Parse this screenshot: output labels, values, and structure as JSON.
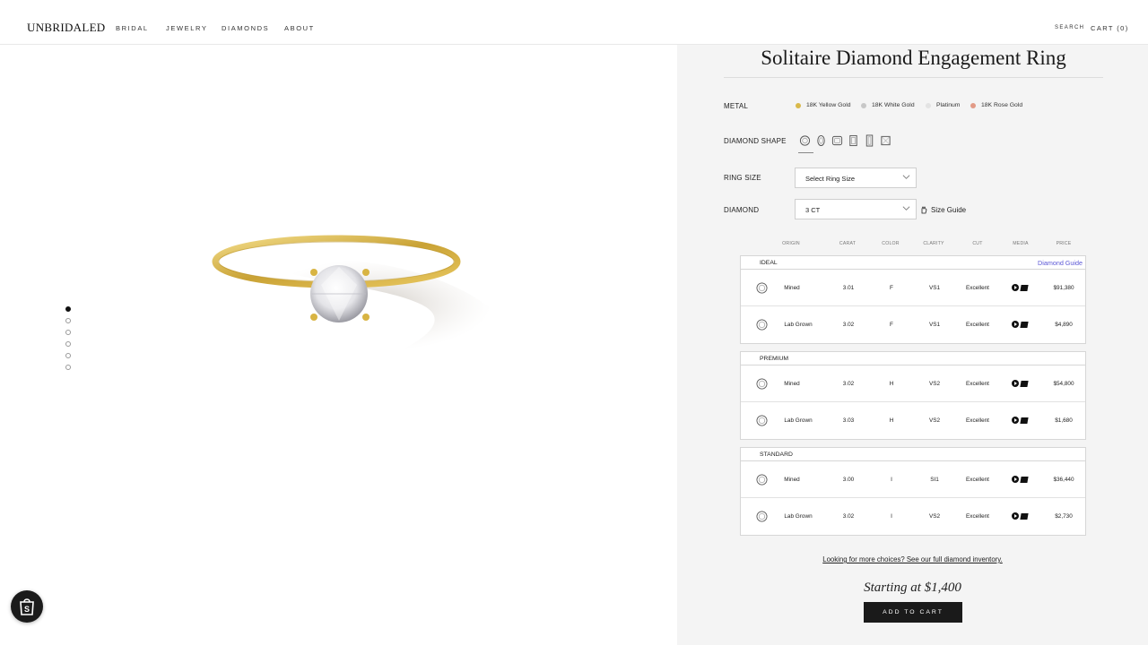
{
  "header": {
    "logo": "UNBRIDALED",
    "nav": [
      "BRIDAL",
      "JEWELRY",
      "DIAMONDS",
      "ABOUT"
    ],
    "search": "SEARCH",
    "cart": "CART (0)"
  },
  "gallery": {
    "image_count": 6,
    "active_index": 0
  },
  "product": {
    "title": "Solitaire Diamond Engagement Ring",
    "metal_label": "METAL",
    "metals": [
      {
        "name": "18K Yellow Gold",
        "color": "#d9b94a"
      },
      {
        "name": "18K White Gold",
        "color": "#c7c7c7"
      },
      {
        "name": "Platinum",
        "color": "#e3e3e3"
      },
      {
        "name": "18K Rose Gold",
        "color": "#e29a86"
      }
    ],
    "shape_label": "DIAMOND SHAPE",
    "shapes": [
      "round-icon",
      "oval-icon",
      "cushion-icon",
      "emerald-icon",
      "elongated-emerald-icon",
      "princess-icon"
    ],
    "ring_size_label": "RING SIZE",
    "ring_size_value": "Select Ring Size",
    "diamond_label": "DIAMOND",
    "diamond_value": "3 CT",
    "size_guide": "Size Guide"
  },
  "table": {
    "headers": [
      "ORIGIN",
      "CARAT",
      "COLOR",
      "CLARITY",
      "CUT",
      "MEDIA",
      "PRICE"
    ],
    "diamond_guide": "Diamond Guide",
    "groups": [
      {
        "name": "IDEAL",
        "rows": [
          {
            "origin": "Mined",
            "carat": "3.01",
            "color": "F",
            "clarity": "VS1",
            "cut": "Excellent",
            "price": "$91,380"
          },
          {
            "origin": "Lab Grown",
            "carat": "3.02",
            "color": "F",
            "clarity": "VS1",
            "cut": "Excellent",
            "price": "$4,890"
          }
        ]
      },
      {
        "name": "PREMIUM",
        "rows": [
          {
            "origin": "Mined",
            "carat": "3.02",
            "color": "H",
            "clarity": "VS2",
            "cut": "Excellent",
            "price": "$54,800"
          },
          {
            "origin": "Lab Grown",
            "carat": "3.03",
            "color": "H",
            "clarity": "VS2",
            "cut": "Excellent",
            "price": "$1,680"
          }
        ]
      },
      {
        "name": "STANDARD",
        "rows": [
          {
            "origin": "Mined",
            "carat": "3.00",
            "color": "I",
            "clarity": "SI1",
            "cut": "Excellent",
            "price": "$36,440"
          },
          {
            "origin": "Lab Grown",
            "carat": "3.02",
            "color": "I",
            "clarity": "VS2",
            "cut": "Excellent",
            "price": "$2,730"
          }
        ]
      }
    ]
  },
  "footer": {
    "more_link": "Looking for more choices? See our full diamond inventory.",
    "starting_at": "Starting at $1,400",
    "add_to_cart": "ADD TO CART"
  }
}
